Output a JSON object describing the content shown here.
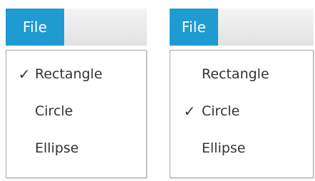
{
  "menus": [
    {
      "file_label": "File",
      "items": [
        {
          "label": "Rectangle",
          "check": "✓"
        },
        {
          "label": "Circle",
          "check": ""
        },
        {
          "label": "Ellipse",
          "check": ""
        }
      ]
    },
    {
      "file_label": "File",
      "items": [
        {
          "label": "Rectangle",
          "check": ""
        },
        {
          "label": "Circle",
          "check": "✓"
        },
        {
          "label": "Ellipse",
          "check": ""
        }
      ]
    }
  ],
  "colors": {
    "menu_accent": "#1e9bd1",
    "menubar_bg": "#e8e8e8"
  }
}
